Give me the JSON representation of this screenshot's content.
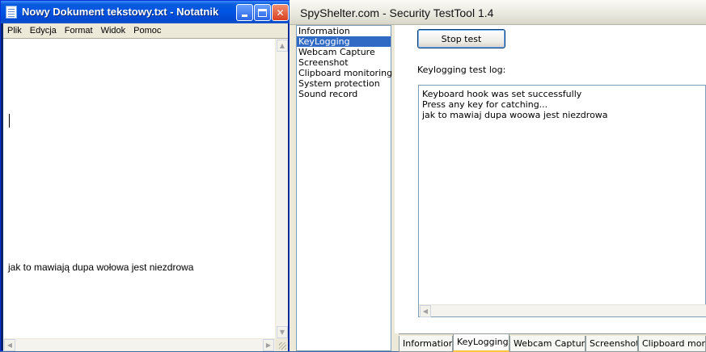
{
  "notepad": {
    "title": "Nowy Dokument tekstowy.txt - Notatnik",
    "menu": [
      "Plik",
      "Edycja",
      "Format",
      "Widok",
      "Pomoc"
    ],
    "content": "jak to mawiają dupa wołowa jest niezdrowa",
    "controls": {
      "minimize": "minimize-icon",
      "maximize": "maximize-icon",
      "close": "close-icon",
      "close_glyph": "✕"
    }
  },
  "spyshelter": {
    "title": "SpyShelter.com - Security TestTool  1.4",
    "nav": [
      "Information",
      "KeyLogging",
      "Webcam Capture",
      "Screenshot",
      "Clipboard monitoring",
      "System protection",
      "Sound record"
    ],
    "selected_nav": "KeyLogging",
    "stop_button": "Stop test",
    "log_label": "Keylogging test log:",
    "log_lines": [
      "Keyboard hook was set successfully",
      "Press any key for catching...",
      "jak to mawiaj dupa woowa jest niezdrowa"
    ],
    "tabs": [
      "Information",
      "KeyLogging",
      "Webcam Capture",
      "Screenshot",
      "Clipboard monito"
    ],
    "active_tab": "KeyLogging"
  },
  "colors": {
    "xp_blue": "#0054e3",
    "selection": "#316ac5",
    "tab_highlight": "#ffc83c"
  }
}
